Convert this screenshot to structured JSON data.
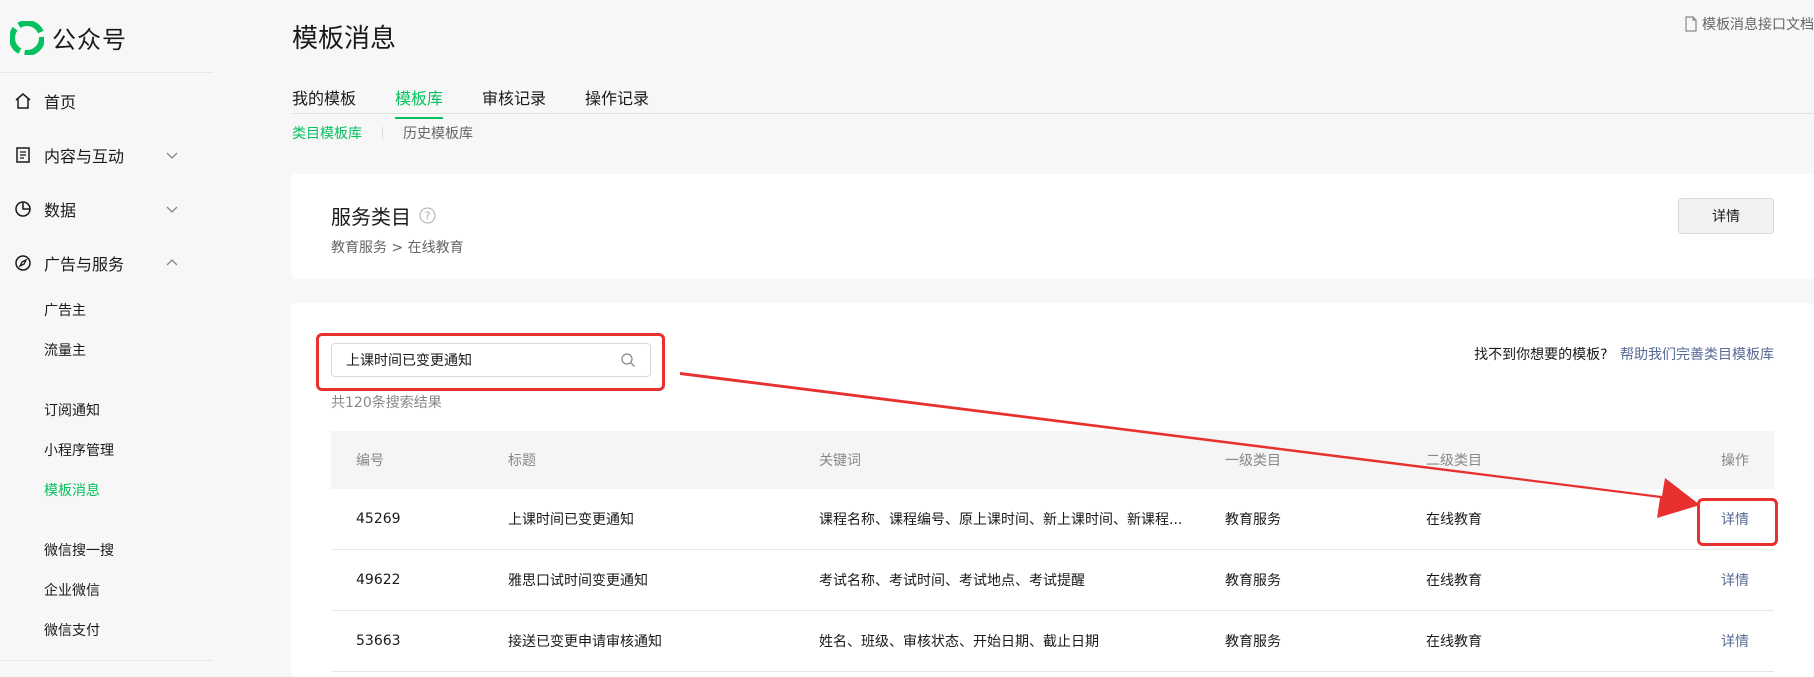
{
  "brand": {
    "name": "公众号",
    "logo_icon": "wechat-official-account-logo",
    "color": "#07c160"
  },
  "sidebar": {
    "items": [
      {
        "label": "首页",
        "icon": "home-icon"
      },
      {
        "label": "内容与互动",
        "icon": "document-icon",
        "expand": "chevron-down-icon"
      },
      {
        "label": "数据",
        "icon": "pie-chart-icon",
        "expand": "chevron-down-icon"
      },
      {
        "label": "广告与服务",
        "icon": "compass-icon",
        "expand": "chevron-up-icon"
      }
    ],
    "sub_items": [
      "广告主",
      "流量主",
      "订阅通知",
      "小程序管理",
      "模板消息",
      "微信搜一搜",
      "企业微信",
      "微信支付"
    ],
    "active_sub": "模板消息"
  },
  "header": {
    "title": "模板消息",
    "doc_link": "模板消息接口文档",
    "tabs": [
      {
        "label": "我的模板"
      },
      {
        "label": "模板库"
      },
      {
        "label": "审核记录"
      },
      {
        "label": "操作记录"
      }
    ],
    "active_tab": "模板库",
    "subtabs": [
      {
        "label": "类目模板库"
      },
      {
        "label": "历史模板库"
      }
    ],
    "active_subtab": "类目模板库"
  },
  "service": {
    "title": "服务类目",
    "path": "教育服务 > 在线教育",
    "detail_button": "详情"
  },
  "search": {
    "value": "上课时间已变更通知",
    "result_count": "共120条搜索结果",
    "cant_find": "找不到你想要的模板?",
    "help_link": "帮助我们完善类目模板库"
  },
  "table": {
    "headers": [
      "编号",
      "标题",
      "关键词",
      "一级类目",
      "二级类目",
      "操作"
    ],
    "rows": [
      {
        "id": "45269",
        "title": "上课时间已变更通知",
        "keywords": "课程名称、课程编号、原上课时间、新上课时间、新课程...",
        "cat1": "教育服务",
        "cat2": "在线教育",
        "op": "详情"
      },
      {
        "id": "49622",
        "title": "雅思口试时间变更通知",
        "keywords": "考试名称、考试时间、考试地点、考试提醒",
        "cat1": "教育服务",
        "cat2": "在线教育",
        "op": "详情"
      },
      {
        "id": "53663",
        "title": "接送已变更申请审核通知",
        "keywords": "姓名、班级、审核状态、开始日期、截止日期",
        "cat1": "教育服务",
        "cat2": "在线教育",
        "op": "详情"
      }
    ]
  },
  "colors": {
    "accent": "#07c160",
    "link": "#576b95",
    "annotation": "#e8312f"
  }
}
